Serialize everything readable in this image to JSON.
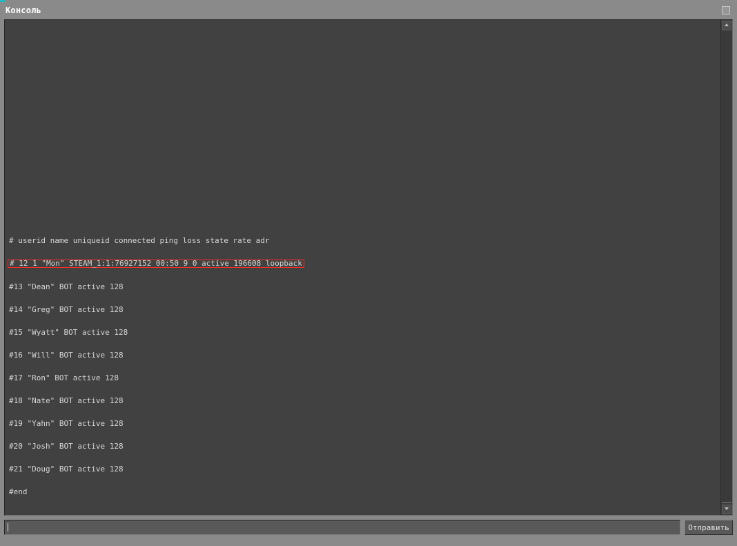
{
  "window": {
    "title": "Консоль"
  },
  "console": {
    "lines": [
      "# userid name uniqueid connected ping loss state rate adr",
      "# 12 1 \"Mon\" STEAM_1:1:76927152 00:50 9 0 active 196608 loopback",
      "#13 \"Dean\" BOT active 128",
      "#14 \"Greg\" BOT active 128",
      "#15 \"Wyatt\" BOT active 128",
      "#16 \"Will\" BOT active 128",
      "#17 \"Ron\" BOT active 128",
      "#18 \"Nate\" BOT active 128",
      "#19 \"Yahn\" BOT active 128",
      "#20 \"Josh\" BOT active 128",
      "#21 \"Doug\" BOT active 128",
      "#end"
    ],
    "highlighted_line_index": 1,
    "input_value": ""
  },
  "buttons": {
    "send_label": "Отправить"
  }
}
